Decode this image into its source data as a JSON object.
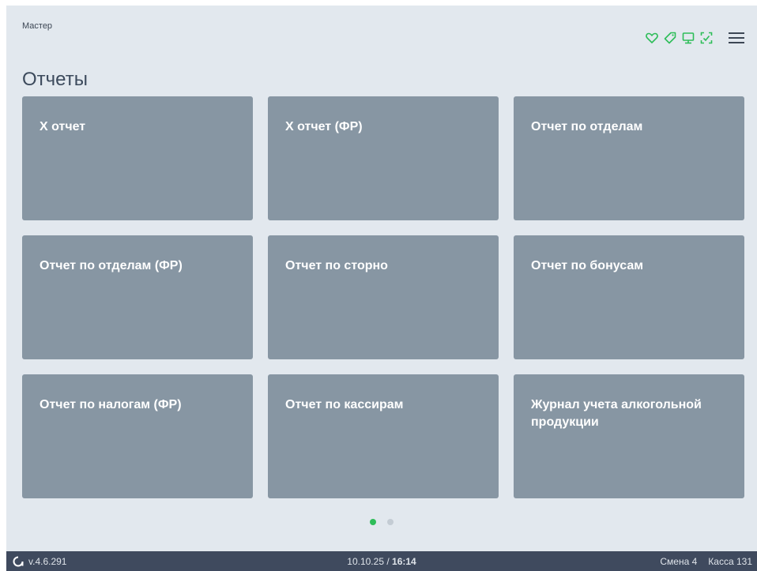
{
  "header": {
    "title": "Мастер",
    "icons": [
      "heart-icon",
      "tag-icon",
      "monitor-icon",
      "scan-icon"
    ],
    "menu_icon": "hamburger-menu-icon",
    "accent_color": "#2ebd59"
  },
  "page": {
    "title": "Отчеты"
  },
  "tiles": [
    {
      "label": "X отчет"
    },
    {
      "label": "X отчет (ФР)"
    },
    {
      "label": "Отчет по отделам"
    },
    {
      "label": "Отчет по отделам (ФР)"
    },
    {
      "label": "Отчет по сторно"
    },
    {
      "label": "Отчет по бонусам"
    },
    {
      "label": "Отчет по налогам (ФР)"
    },
    {
      "label": "Отчет по кассирам"
    },
    {
      "label": "Журнал учета алкогольной продукции"
    }
  ],
  "pagination": {
    "pages": 2,
    "current": 1
  },
  "status_bar": {
    "version": "v.4.6.291",
    "date": "10.10.25",
    "separator": " / ",
    "time": "16:14",
    "shift": "Смена 4",
    "register": "Касса 131"
  },
  "colors": {
    "tile": "#8796a3",
    "background": "#e2e8ee",
    "status_bar": "#3f4a5e"
  }
}
